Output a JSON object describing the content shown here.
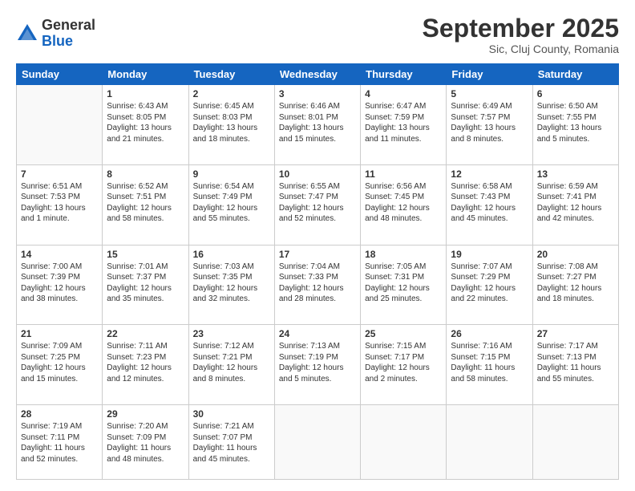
{
  "logo": {
    "general": "General",
    "blue": "Blue"
  },
  "header": {
    "month": "September 2025",
    "location": "Sic, Cluj County, Romania"
  },
  "weekdays": [
    "Sunday",
    "Monday",
    "Tuesday",
    "Wednesday",
    "Thursday",
    "Friday",
    "Saturday"
  ],
  "weeks": [
    [
      {
        "day": "",
        "info": ""
      },
      {
        "day": "1",
        "info": "Sunrise: 6:43 AM\nSunset: 8:05 PM\nDaylight: 13 hours\nand 21 minutes."
      },
      {
        "day": "2",
        "info": "Sunrise: 6:45 AM\nSunset: 8:03 PM\nDaylight: 13 hours\nand 18 minutes."
      },
      {
        "day": "3",
        "info": "Sunrise: 6:46 AM\nSunset: 8:01 PM\nDaylight: 13 hours\nand 15 minutes."
      },
      {
        "day": "4",
        "info": "Sunrise: 6:47 AM\nSunset: 7:59 PM\nDaylight: 13 hours\nand 11 minutes."
      },
      {
        "day": "5",
        "info": "Sunrise: 6:49 AM\nSunset: 7:57 PM\nDaylight: 13 hours\nand 8 minutes."
      },
      {
        "day": "6",
        "info": "Sunrise: 6:50 AM\nSunset: 7:55 PM\nDaylight: 13 hours\nand 5 minutes."
      }
    ],
    [
      {
        "day": "7",
        "info": "Sunrise: 6:51 AM\nSunset: 7:53 PM\nDaylight: 13 hours\nand 1 minute."
      },
      {
        "day": "8",
        "info": "Sunrise: 6:52 AM\nSunset: 7:51 PM\nDaylight: 12 hours\nand 58 minutes."
      },
      {
        "day": "9",
        "info": "Sunrise: 6:54 AM\nSunset: 7:49 PM\nDaylight: 12 hours\nand 55 minutes."
      },
      {
        "day": "10",
        "info": "Sunrise: 6:55 AM\nSunset: 7:47 PM\nDaylight: 12 hours\nand 52 minutes."
      },
      {
        "day": "11",
        "info": "Sunrise: 6:56 AM\nSunset: 7:45 PM\nDaylight: 12 hours\nand 48 minutes."
      },
      {
        "day": "12",
        "info": "Sunrise: 6:58 AM\nSunset: 7:43 PM\nDaylight: 12 hours\nand 45 minutes."
      },
      {
        "day": "13",
        "info": "Sunrise: 6:59 AM\nSunset: 7:41 PM\nDaylight: 12 hours\nand 42 minutes."
      }
    ],
    [
      {
        "day": "14",
        "info": "Sunrise: 7:00 AM\nSunset: 7:39 PM\nDaylight: 12 hours\nand 38 minutes."
      },
      {
        "day": "15",
        "info": "Sunrise: 7:01 AM\nSunset: 7:37 PM\nDaylight: 12 hours\nand 35 minutes."
      },
      {
        "day": "16",
        "info": "Sunrise: 7:03 AM\nSunset: 7:35 PM\nDaylight: 12 hours\nand 32 minutes."
      },
      {
        "day": "17",
        "info": "Sunrise: 7:04 AM\nSunset: 7:33 PM\nDaylight: 12 hours\nand 28 minutes."
      },
      {
        "day": "18",
        "info": "Sunrise: 7:05 AM\nSunset: 7:31 PM\nDaylight: 12 hours\nand 25 minutes."
      },
      {
        "day": "19",
        "info": "Sunrise: 7:07 AM\nSunset: 7:29 PM\nDaylight: 12 hours\nand 22 minutes."
      },
      {
        "day": "20",
        "info": "Sunrise: 7:08 AM\nSunset: 7:27 PM\nDaylight: 12 hours\nand 18 minutes."
      }
    ],
    [
      {
        "day": "21",
        "info": "Sunrise: 7:09 AM\nSunset: 7:25 PM\nDaylight: 12 hours\nand 15 minutes."
      },
      {
        "day": "22",
        "info": "Sunrise: 7:11 AM\nSunset: 7:23 PM\nDaylight: 12 hours\nand 12 minutes."
      },
      {
        "day": "23",
        "info": "Sunrise: 7:12 AM\nSunset: 7:21 PM\nDaylight: 12 hours\nand 8 minutes."
      },
      {
        "day": "24",
        "info": "Sunrise: 7:13 AM\nSunset: 7:19 PM\nDaylight: 12 hours\nand 5 minutes."
      },
      {
        "day": "25",
        "info": "Sunrise: 7:15 AM\nSunset: 7:17 PM\nDaylight: 12 hours\nand 2 minutes."
      },
      {
        "day": "26",
        "info": "Sunrise: 7:16 AM\nSunset: 7:15 PM\nDaylight: 11 hours\nand 58 minutes."
      },
      {
        "day": "27",
        "info": "Sunrise: 7:17 AM\nSunset: 7:13 PM\nDaylight: 11 hours\nand 55 minutes."
      }
    ],
    [
      {
        "day": "28",
        "info": "Sunrise: 7:19 AM\nSunset: 7:11 PM\nDaylight: 11 hours\nand 52 minutes."
      },
      {
        "day": "29",
        "info": "Sunrise: 7:20 AM\nSunset: 7:09 PM\nDaylight: 11 hours\nand 48 minutes."
      },
      {
        "day": "30",
        "info": "Sunrise: 7:21 AM\nSunset: 7:07 PM\nDaylight: 11 hours\nand 45 minutes."
      },
      {
        "day": "",
        "info": ""
      },
      {
        "day": "",
        "info": ""
      },
      {
        "day": "",
        "info": ""
      },
      {
        "day": "",
        "info": ""
      }
    ]
  ]
}
